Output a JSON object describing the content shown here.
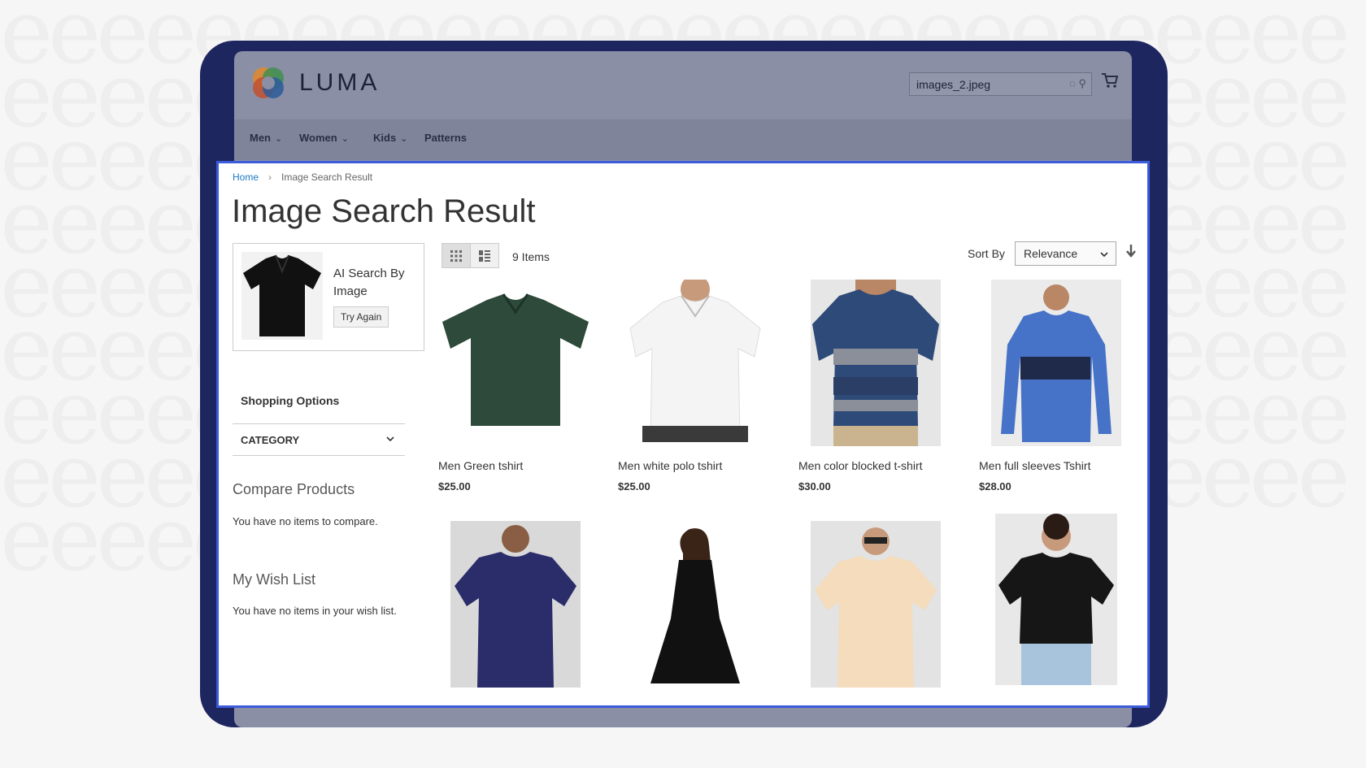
{
  "header": {
    "logo_text": "LUMA",
    "search_value": "images_2.jpeg"
  },
  "nav": [
    {
      "label": "Men"
    },
    {
      "label": "Women"
    },
    {
      "label": "Kids"
    },
    {
      "label": "Patterns"
    }
  ],
  "breadcrumb": {
    "home": "Home",
    "current": "Image Search Result"
  },
  "page_title": "Image Search Result",
  "ai_search": {
    "label": "AI Search By Image",
    "button": "Try Again"
  },
  "sidebar": {
    "shopping_options": "Shopping Options",
    "category": "CATEGORY",
    "compare_title": "Compare Products",
    "compare_text": "You have no items to compare.",
    "wishlist_title": "My Wish List",
    "wishlist_text": "You have no items in your wish list."
  },
  "toolbar": {
    "items_count": "9 Items",
    "sort_label": "Sort By",
    "sort_value": "Relevance"
  },
  "products": [
    {
      "name": "Men Green tshirt",
      "price": "$25.00",
      "color": "#2d4a3a"
    },
    {
      "name": "Men white polo tshirt",
      "price": "$25.00",
      "color": "#f1f1f1"
    },
    {
      "name": "Men color blocked t-shirt",
      "price": "$30.00",
      "color": "#2e4a78"
    },
    {
      "name": "Men full sleeves Tshirt",
      "price": "$28.00",
      "color": "#4672c8"
    },
    {
      "name": "",
      "price": "",
      "color": "#2b2d6b"
    },
    {
      "name": "",
      "price": "",
      "color": "#111111"
    },
    {
      "name": "",
      "price": "",
      "color": "#f4dcbc"
    },
    {
      "name": "",
      "price": "",
      "color": "#161616"
    }
  ],
  "colors": {
    "accent_border": "#3b5bdb",
    "device_frame": "#1e2660",
    "link": "#1979c3"
  }
}
